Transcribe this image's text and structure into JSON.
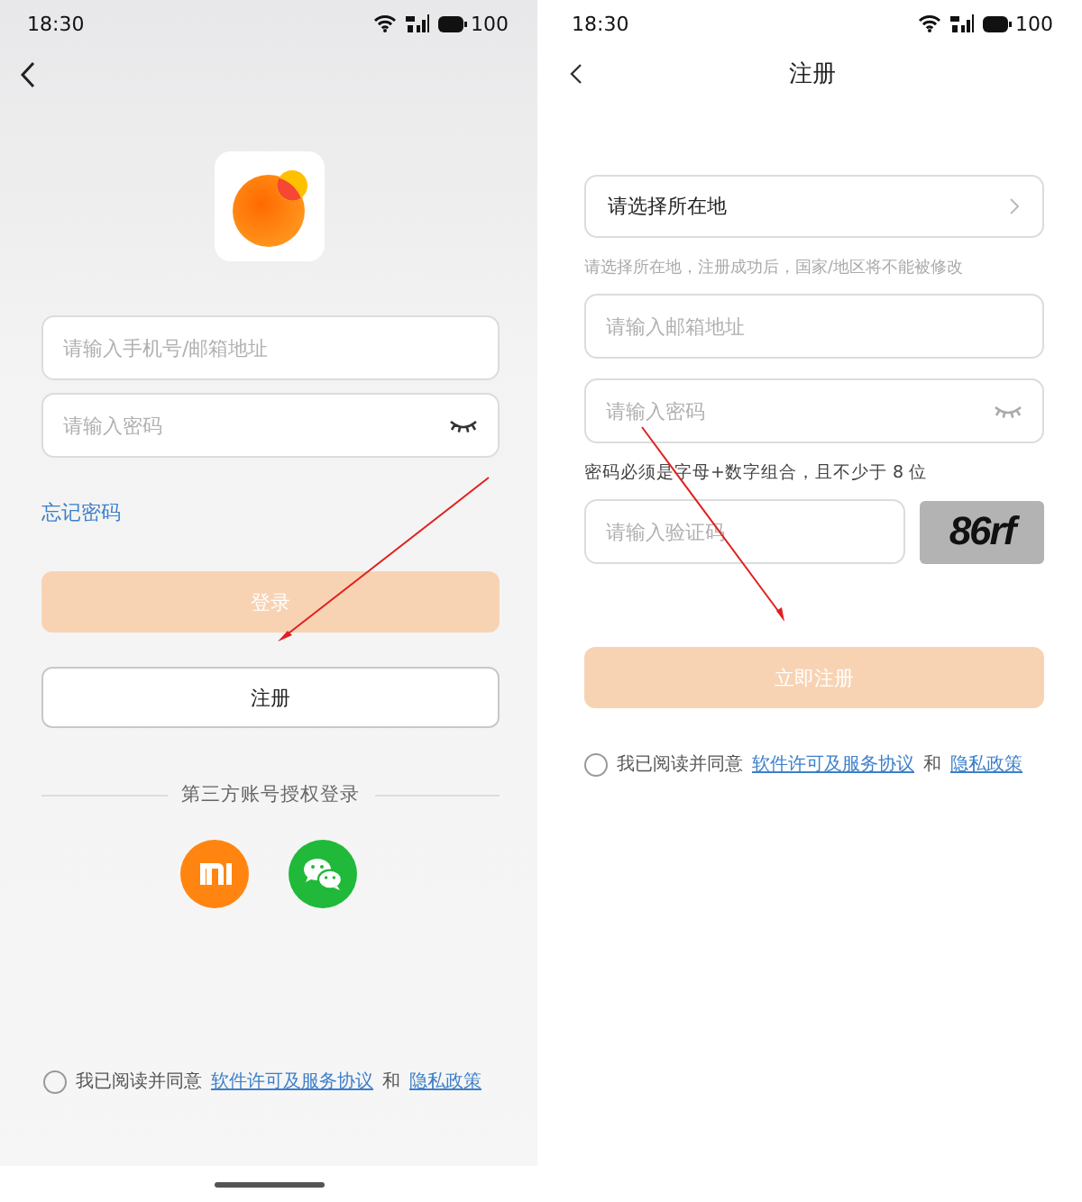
{
  "login_screen": {
    "status_bar": {
      "time": "18:30",
      "battery": "100"
    },
    "fields": [
      {
        "kind": "text",
        "placeholder": "请输入手机号/邮箱地址"
      },
      {
        "kind": "password",
        "placeholder": "请输入密码"
      }
    ],
    "forgot_link": "忘记密码",
    "login_button": {
      "label": "登录",
      "disabled": true
    },
    "register_button": {
      "label": "注册"
    },
    "third_party_label": "第三方账号授权登录",
    "agreement": {
      "checked": false,
      "text": "我已阅读并同意",
      "terms_link": "软件许可及服务协议",
      "and": "和",
      "privacy_link": "隐私政策"
    }
  },
  "register_screen": {
    "status_bar": {
      "time": "18:30",
      "battery": "100"
    },
    "title": "注册",
    "location_picker": {
      "label": "请选择所在地"
    },
    "location_hint": "请选择所在地，注册成功后，国家/地区将不能被修改",
    "fields": [
      {
        "kind": "text",
        "placeholder": "请输入邮箱地址"
      },
      {
        "kind": "password",
        "placeholder": "请输入密码"
      }
    ],
    "password_rule": "密码必须是字母+数字组合，且不少于 8 位",
    "captcha_field": {
      "placeholder": "请输入验证码"
    },
    "captcha_image": "86rf",
    "submit_button": {
      "label": "立即注册",
      "disabled": true
    },
    "agreement": {
      "checked": false,
      "text": "我已阅读并同意",
      "terms_link": "软件许可及服务协议",
      "and": "和",
      "privacy_link": "隐私政策"
    }
  }
}
